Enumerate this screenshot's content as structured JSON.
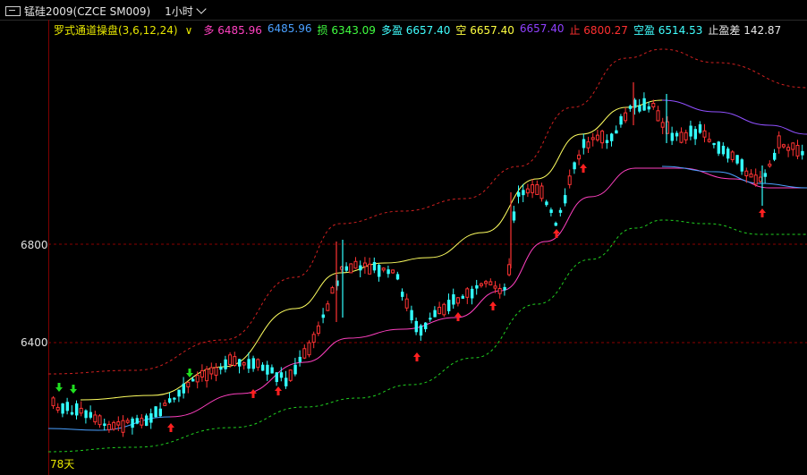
{
  "header": {
    "contract_icon": "contract-icon",
    "symbol": "锰硅2009(CZCE SM009)",
    "period": "1小时"
  },
  "indicator": {
    "name": "罗式通道操盘(3,6,12,24)",
    "items": [
      {
        "label": "多",
        "value": "6485.96",
        "color": "#ff40c0"
      },
      {
        "label": "",
        "value": "6485.96",
        "color": "#4aa0ff"
      },
      {
        "label": "损",
        "value": "6343.09",
        "color": "#40ff40"
      },
      {
        "label": "多盈",
        "value": "6657.40",
        "color": "#40ffff"
      },
      {
        "label": "空",
        "value": "6657.40",
        "color": "#ffff40"
      },
      {
        "label": "",
        "value": "6657.40",
        "color": "#9040ff"
      },
      {
        "label": "止",
        "value": "6800.27",
        "color": "#ff3030"
      },
      {
        "label": "空盈",
        "value": "6514.53",
        "color": "#40ffff"
      },
      {
        "label": "止盈差",
        "value": "142.87",
        "color": "#e6e6e6"
      }
    ]
  },
  "y_axis": {
    "ticks": [
      "6800",
      "6400"
    ]
  },
  "footer": {
    "days": "78天"
  },
  "colors": {
    "up": "#ff3333",
    "down": "#33ffff",
    "bg": "#000000",
    "grid": "#8b0000"
  }
}
